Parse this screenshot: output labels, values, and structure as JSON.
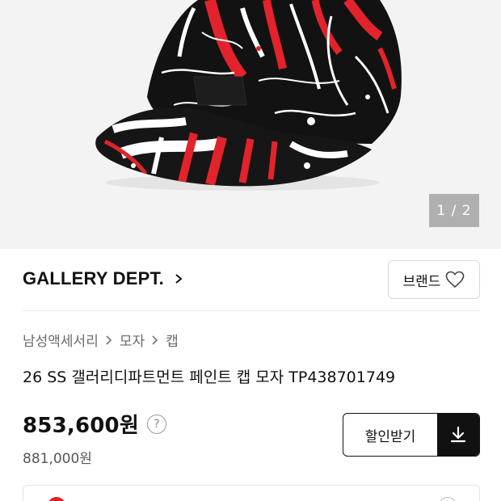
{
  "gallery": {
    "image_alt": "paint-splatter black cap",
    "page_indicator": "1 / 2"
  },
  "brand": {
    "name": "GALLERY DEPT.",
    "button_label": "브랜드"
  },
  "breadcrumb": [
    "남성액세서리",
    "모자",
    "캡"
  ],
  "product": {
    "title": "26 SS 갤러리디파트먼트 페인트 캡 모자 TP438701749",
    "price": "853,600원",
    "original_price": "881,000원"
  },
  "coupon": {
    "label": "할인받기"
  },
  "colors": {
    "splatter_red": "#e3232b",
    "cap_black": "#111111",
    "background": "#f3f3f3"
  }
}
